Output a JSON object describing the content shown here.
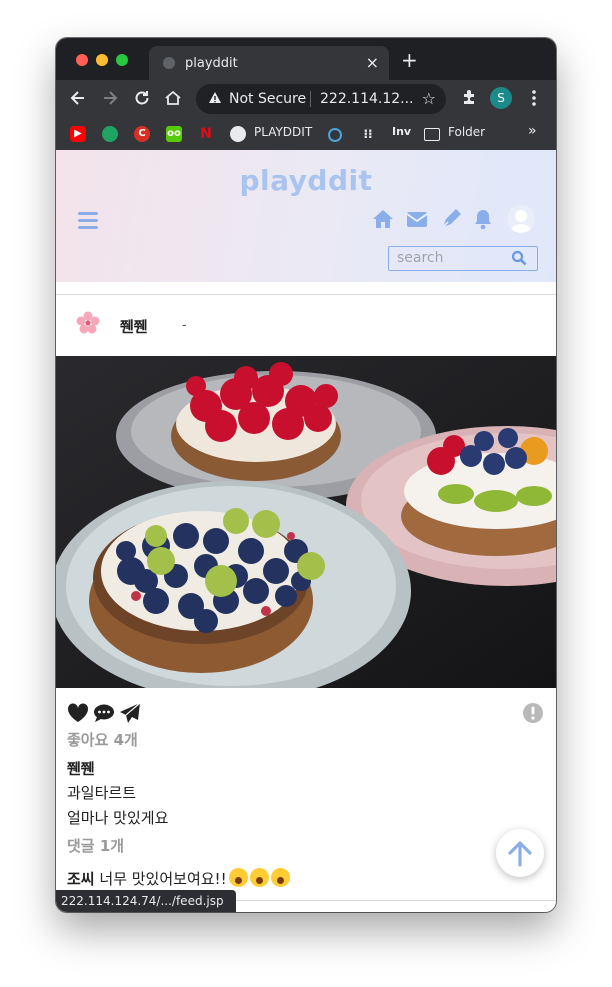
{
  "browser": {
    "tab_title": "playddit",
    "tab_close": "×",
    "new_tab": "+",
    "security_label": "Not Secure",
    "url": "222.114.12...",
    "profile_initial": "S",
    "bookmarks": [
      {
        "icon": "youtube-icon",
        "label": ""
      },
      {
        "icon": "green-circle-icon",
        "label": ""
      },
      {
        "icon": "red-c-icon",
        "label": ""
      },
      {
        "icon": "owl-icon",
        "label": ""
      },
      {
        "icon": "netflix-icon",
        "label": ""
      },
      {
        "icon": "github-icon",
        "label": "PLAYDDIT"
      },
      {
        "icon": "blue-swirl-icon",
        "label": ""
      },
      {
        "icon": "dots-icon",
        "label": ""
      },
      {
        "icon": "inv-icon",
        "label": "Inv"
      },
      {
        "icon": "folder-icon",
        "label": "Folder"
      }
    ],
    "more_bookmarks": "»",
    "status_url": "222.114.124.74/.../feed.jsp"
  },
  "site": {
    "logo": "playddit",
    "search": {
      "placeholder": "search"
    },
    "accent": "#8aaee9"
  },
  "post": {
    "username": "쮄쮄",
    "separator": "-",
    "likes": "좋아요 4개",
    "caption_user": "쮄쮄",
    "caption_lines": [
      "과일타르트",
      "얼마나 맛있게요"
    ],
    "comment_count": "댓글 1개",
    "comments": [
      {
        "user": "조씨",
        "text": "너무 맛있어보여요!!"
      }
    ]
  }
}
